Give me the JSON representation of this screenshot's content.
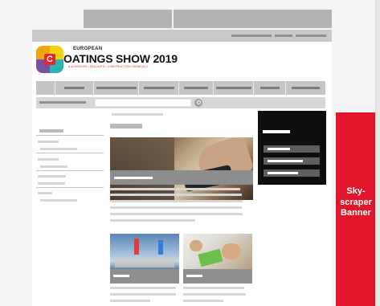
{
  "logo": {
    "small": "EUROPEAN",
    "mark_letter": "C",
    "main": "OATINGS SHOW 2019",
    "tagline": "● ADHESIVES • SEALANTS • CONSTRUCTION CHEMICALS"
  },
  "skyscraper": {
    "line1": "Sky-",
    "line2": "scraper",
    "line3": "Banner"
  },
  "colors": {
    "skyscraper_bg": "#e0162b",
    "sidebar_box_bg": "#0e0e0e",
    "placeholder_gray": "#b9b9b9"
  },
  "icons": {
    "search": "search-icon"
  }
}
